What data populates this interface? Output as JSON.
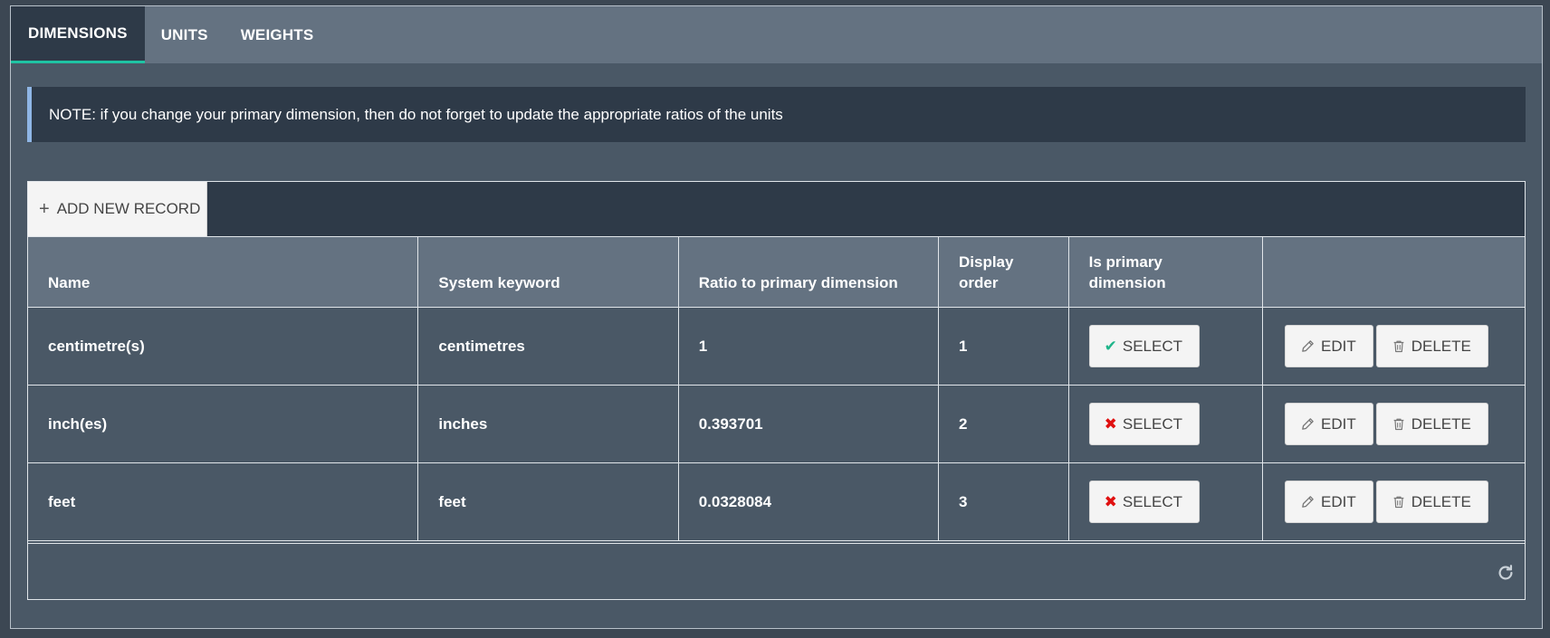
{
  "tabs": [
    {
      "label": "DIMENSIONS",
      "active": true
    },
    {
      "label": "UNITS",
      "active": false
    },
    {
      "label": "WEIGHTS",
      "active": false
    }
  ],
  "note": "NOTE: if you change your primary dimension, then do not forget to update the appropriate ratios of the units",
  "toolbar": {
    "add_label": "ADD NEW RECORD",
    "add_icon": "plus-icon"
  },
  "columns": [
    "Name",
    "System keyword",
    "Ratio to primary dimension",
    "Display order",
    "Is primary dimension",
    ""
  ],
  "rows": [
    {
      "name": "centimetre(s)",
      "keyword": "centimetres",
      "ratio": "1",
      "order": "1",
      "is_primary": true
    },
    {
      "name": "inch(es)",
      "keyword": "inches",
      "ratio": "0.393701",
      "order": "2",
      "is_primary": false
    },
    {
      "name": "feet",
      "keyword": "feet",
      "ratio": "0.0328084",
      "order": "3",
      "is_primary": false
    }
  ],
  "buttons": {
    "select": "SELECT",
    "edit": "EDIT",
    "delete": "DELETE"
  },
  "icons": {
    "primary_yes": "check-icon",
    "primary_no": "x-icon",
    "edit": "pencil-icon",
    "delete": "trash-icon",
    "refresh": "refresh-icon"
  },
  "colors": {
    "accent": "#1fc3a3",
    "check": "#1fb58a",
    "cross": "#e01010",
    "note_border": "#8fb6e6"
  }
}
